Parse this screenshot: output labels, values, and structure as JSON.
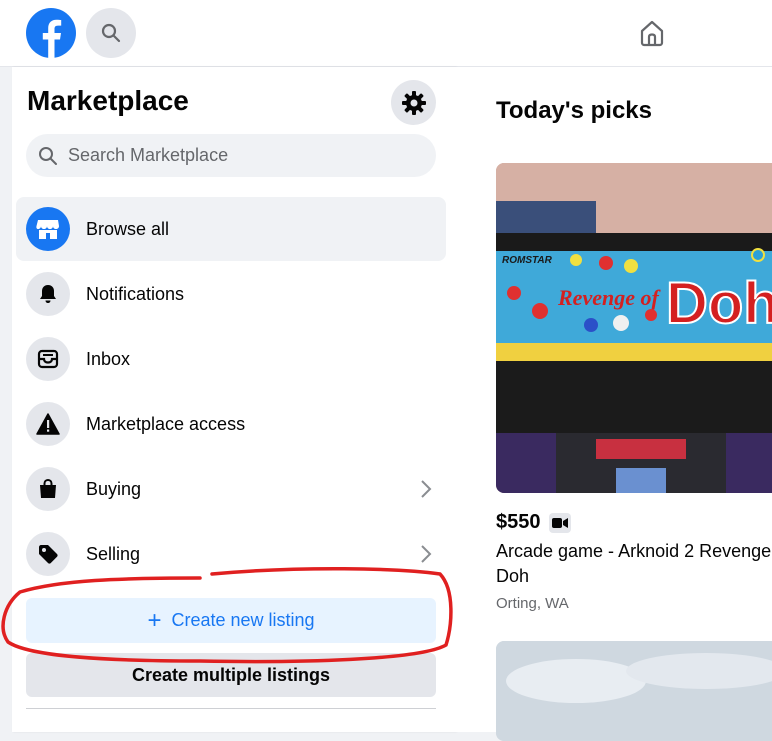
{
  "header": {
    "logo": "facebook-logo",
    "search_icon": "search-icon",
    "home_icon": "home-icon"
  },
  "sidebar": {
    "title": "Marketplace",
    "search_placeholder": "Search Marketplace",
    "items": [
      {
        "label": "Browse all",
        "icon": "storefront-icon",
        "active": true
      },
      {
        "label": "Notifications",
        "icon": "bell-icon"
      },
      {
        "label": "Inbox",
        "icon": "inbox-icon"
      },
      {
        "label": "Marketplace access",
        "icon": "warning-icon"
      },
      {
        "label": "Buying",
        "icon": "shopping-bag-icon",
        "chevron": true
      },
      {
        "label": "Selling",
        "icon": "price-tag-icon",
        "chevron": true
      }
    ],
    "create_listing": "Create new listing",
    "create_multiple": "Create multiple listings"
  },
  "main": {
    "section_title": "Today's picks",
    "listing": {
      "image_text": {
        "brand": "ROMSTAR",
        "game": "Revenge of",
        "doh": "Doh"
      },
      "price": "$550",
      "title_line1": "Arcade game - Arknoid 2 Revenge",
      "title_line2": "Doh",
      "location": "Orting, WA"
    }
  },
  "colors": {
    "brand_blue": "#1877f2",
    "annotation_red": "#e02020"
  }
}
